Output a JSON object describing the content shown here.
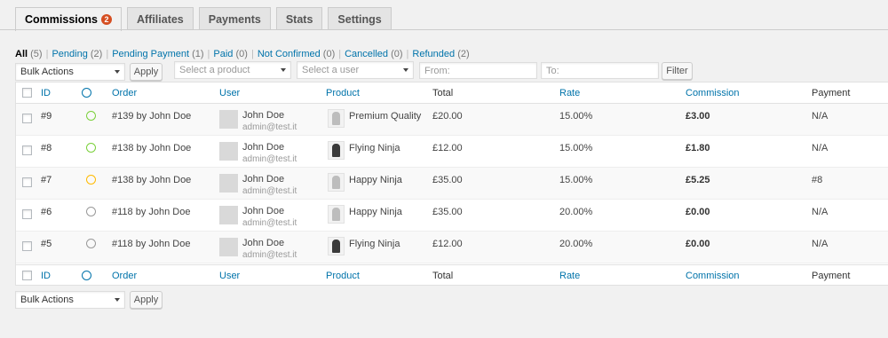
{
  "tabs": [
    {
      "label": "Commissions",
      "badge": "2"
    },
    {
      "label": "Affiliates"
    },
    {
      "label": "Payments"
    },
    {
      "label": "Stats"
    },
    {
      "label": "Settings"
    }
  ],
  "filters": [
    {
      "label": "All",
      "count": "(5)"
    },
    {
      "label": "Pending",
      "count": "(2)"
    },
    {
      "label": "Pending Payment",
      "count": "(1)"
    },
    {
      "label": "Paid",
      "count": "(0)"
    },
    {
      "label": "Not Confirmed",
      "count": "(0)"
    },
    {
      "label": "Cancelled",
      "count": "(0)"
    },
    {
      "label": "Refunded",
      "count": "(2)"
    }
  ],
  "controls": {
    "bulk_actions": "Bulk Actions",
    "apply": "Apply",
    "select_product": "Select a product",
    "select_user": "Select a user",
    "from_placeholder": "From:",
    "to_placeholder": "To:",
    "filter": "Filter"
  },
  "columns": {
    "id": "ID",
    "order": "Order",
    "user": "User",
    "product": "Product",
    "total": "Total",
    "rate": "Rate",
    "commission": "Commission",
    "payment": "Payment"
  },
  "rows": [
    {
      "id": "#9",
      "status": "pending",
      "order": "#139",
      "order_by": " by John Doe",
      "user_name": "John Doe",
      "user_email": "admin@test.it",
      "product": "Premium Quality",
      "total": "£20.00",
      "rate": "15.00%",
      "commission": "£3.00",
      "payment": "N/A"
    },
    {
      "id": "#8",
      "status": "pending",
      "order": "#138",
      "order_by": " by John Doe",
      "user_name": "John Doe",
      "user_email": "admin@test.it",
      "product": "Flying Ninja",
      "total": "£12.00",
      "rate": "15.00%",
      "commission": "£1.80",
      "payment": "N/A"
    },
    {
      "id": "#7",
      "status": "pending-payment",
      "order": "#138",
      "order_by": " by John Doe",
      "user_name": "John Doe",
      "user_email": "admin@test.it",
      "product": "Happy Ninja",
      "total": "£35.00",
      "rate": "15.00%",
      "commission": "£5.25",
      "payment": "#8"
    },
    {
      "id": "#6",
      "status": "refunded",
      "order": "#118",
      "order_by": " by John Doe",
      "user_name": "John Doe",
      "user_email": "admin@test.it",
      "product": "Happy Ninja",
      "total": "£35.00",
      "rate": "20.00%",
      "commission": "£0.00",
      "payment": "N/A"
    },
    {
      "id": "#5",
      "status": "refunded",
      "order": "#118",
      "order_by": " by John Doe",
      "user_name": "John Doe",
      "user_email": "admin@test.it",
      "product": "Flying Ninja",
      "total": "£12.00",
      "rate": "20.00%",
      "commission": "£0.00",
      "payment": "N/A"
    }
  ],
  "colors": {
    "link": "#0073aa",
    "pending": "#7ad03a",
    "pending_payment": "#ffba00",
    "refunded": "#999999",
    "badge": "#d54e21"
  }
}
